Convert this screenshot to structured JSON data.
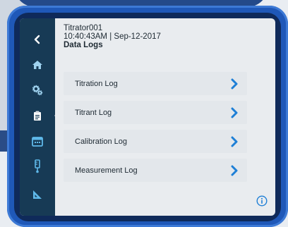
{
  "header": {
    "device_name": "Titrator001",
    "timestamp": "10:40:43AM | Sep-12-2017",
    "title": "Data Logs"
  },
  "sidebar": {
    "items": [
      {
        "icon": "back-chevron-icon"
      },
      {
        "icon": "home-icon"
      },
      {
        "icon": "settings-gears-icon"
      },
      {
        "icon": "data-logs-clipboard-icon",
        "active": true
      },
      {
        "icon": "calendar-icon"
      },
      {
        "icon": "electrode-probe-icon"
      },
      {
        "icon": "triangle-ruler-icon"
      }
    ]
  },
  "logs": {
    "items": [
      {
        "label": "Titration Log"
      },
      {
        "label": "Titrant Log"
      },
      {
        "label": "Calibration Log"
      },
      {
        "label": "Measurement Log"
      }
    ]
  },
  "colors": {
    "accent": "#1e7fd6",
    "sidebar_bg": "#173a55",
    "screen_bg": "#e9ecef",
    "bezel": "#1f58b8"
  },
  "info": {
    "icon": "info-icon"
  }
}
